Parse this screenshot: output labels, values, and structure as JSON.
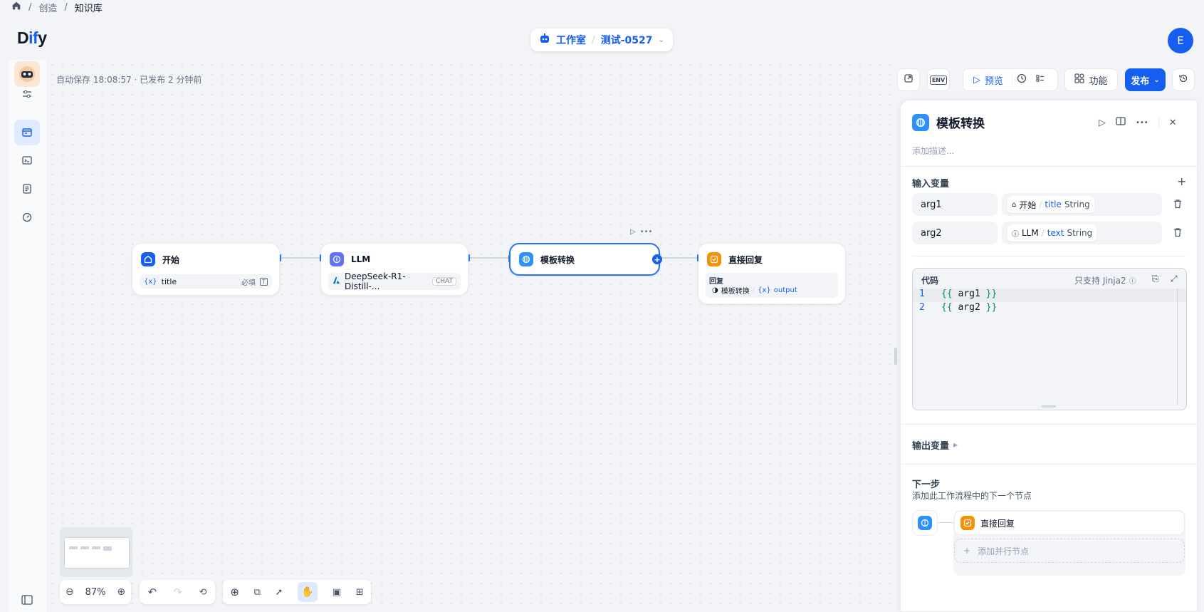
{
  "breadcrumb": {
    "items": [
      "创造",
      "知识库"
    ],
    "sep": "/"
  },
  "header": {
    "logo": "Dify",
    "logo_accent": "if",
    "workspace": "工作室",
    "app_name": "测试-0527",
    "avatar_letter": "E"
  },
  "canvas": {
    "autosave": "自动保存 18:08:57 · 已发布 2 分钟前",
    "zoom": "87%"
  },
  "toolbar": {
    "preview": "预览",
    "features": "功能",
    "publish": "发布"
  },
  "nodes": {
    "start": {
      "title": "开始",
      "var": "title",
      "var_prefix": "{x}",
      "required": "必填"
    },
    "llm": {
      "title": "LLM",
      "model": "DeepSeek-R1-Distill-...",
      "mode": "CHAT"
    },
    "template": {
      "title": "模板转换"
    },
    "answer": {
      "title": "直接回复",
      "label": "回复",
      "ref_node": "模板转换",
      "ref_var": "output",
      "ref_prefix": "{x}"
    }
  },
  "panel": {
    "title": "模板转换",
    "description_placeholder": "添加描述...",
    "input_label": "输入变量",
    "vars": [
      {
        "name": "arg1",
        "node": "开始",
        "var": "title",
        "type": "String"
      },
      {
        "name": "arg2",
        "node": "LLM",
        "var": "text",
        "type": "String"
      }
    ],
    "code_label": "代码",
    "jinja": "只支持 Jinja2",
    "code": [
      {
        "ln": "1",
        "open": "{{",
        "body": " arg1 ",
        "close": "}}"
      },
      {
        "ln": "2",
        "open": "{{",
        "body": " arg2 ",
        "close": "}}"
      }
    ],
    "output_label": "输出变量",
    "next_label": "下一步",
    "next_desc": "添加此工作流程中的下一个节点",
    "next_node": "直接回复",
    "add_parallel": "添加并行节点",
    "add_parallel_prefix": "+"
  },
  "colors": {
    "accent": "#155eef",
    "orange": "#f79009",
    "llm": "#6172f3"
  }
}
